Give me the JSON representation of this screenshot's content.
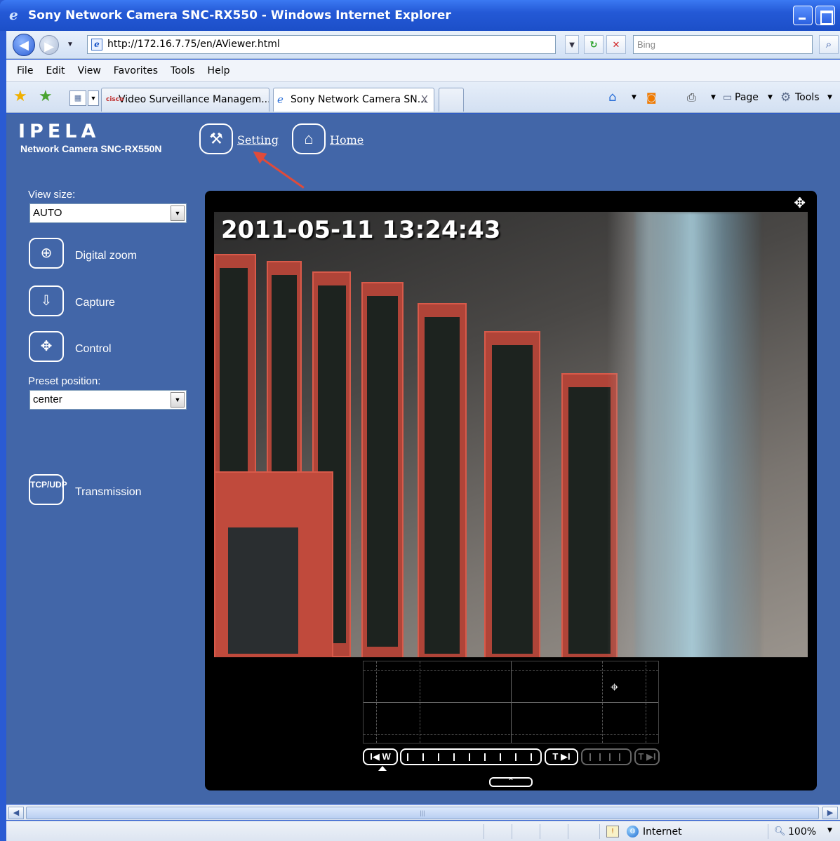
{
  "window": {
    "title": "Sony Network Camera SNC-RX550 - Windows Internet Explorer"
  },
  "navbar": {
    "url": "http://172.16.7.75/en/AViewer.html",
    "search_placeholder": "Bing"
  },
  "menu": {
    "items": [
      "File",
      "Edit",
      "View",
      "Favorites",
      "Tools",
      "Help"
    ]
  },
  "tabs": [
    {
      "label": "Video Surveillance Managem...",
      "icon_text": "cisco"
    },
    {
      "label": "Sony Network Camera SN...",
      "close": "X"
    }
  ],
  "commands": {
    "page": "Page",
    "tools": "Tools"
  },
  "app": {
    "logo": "IPELA",
    "model": "Network Camera SNC-RX550N",
    "nav": {
      "setting": "Setting",
      "home": "Home"
    },
    "sidebar": {
      "view_size_label": "View size:",
      "view_size_value": "AUTO",
      "digital_zoom": "Digital zoom",
      "capture": "Capture",
      "control": "Control",
      "preset_label": "Preset position:",
      "preset_value": "center",
      "transmission": "Transmission",
      "transmission_icon_text": "TCP/UDP"
    },
    "viewer": {
      "timestamp": "2011-05-11  13:24:43",
      "zoom_wide_label": "I◀ W",
      "zoom_tele_label": "T ▶I",
      "zoom_tele_digital_label": "T ▶I"
    }
  },
  "status": {
    "zone": "Internet",
    "zoom": "100%"
  }
}
